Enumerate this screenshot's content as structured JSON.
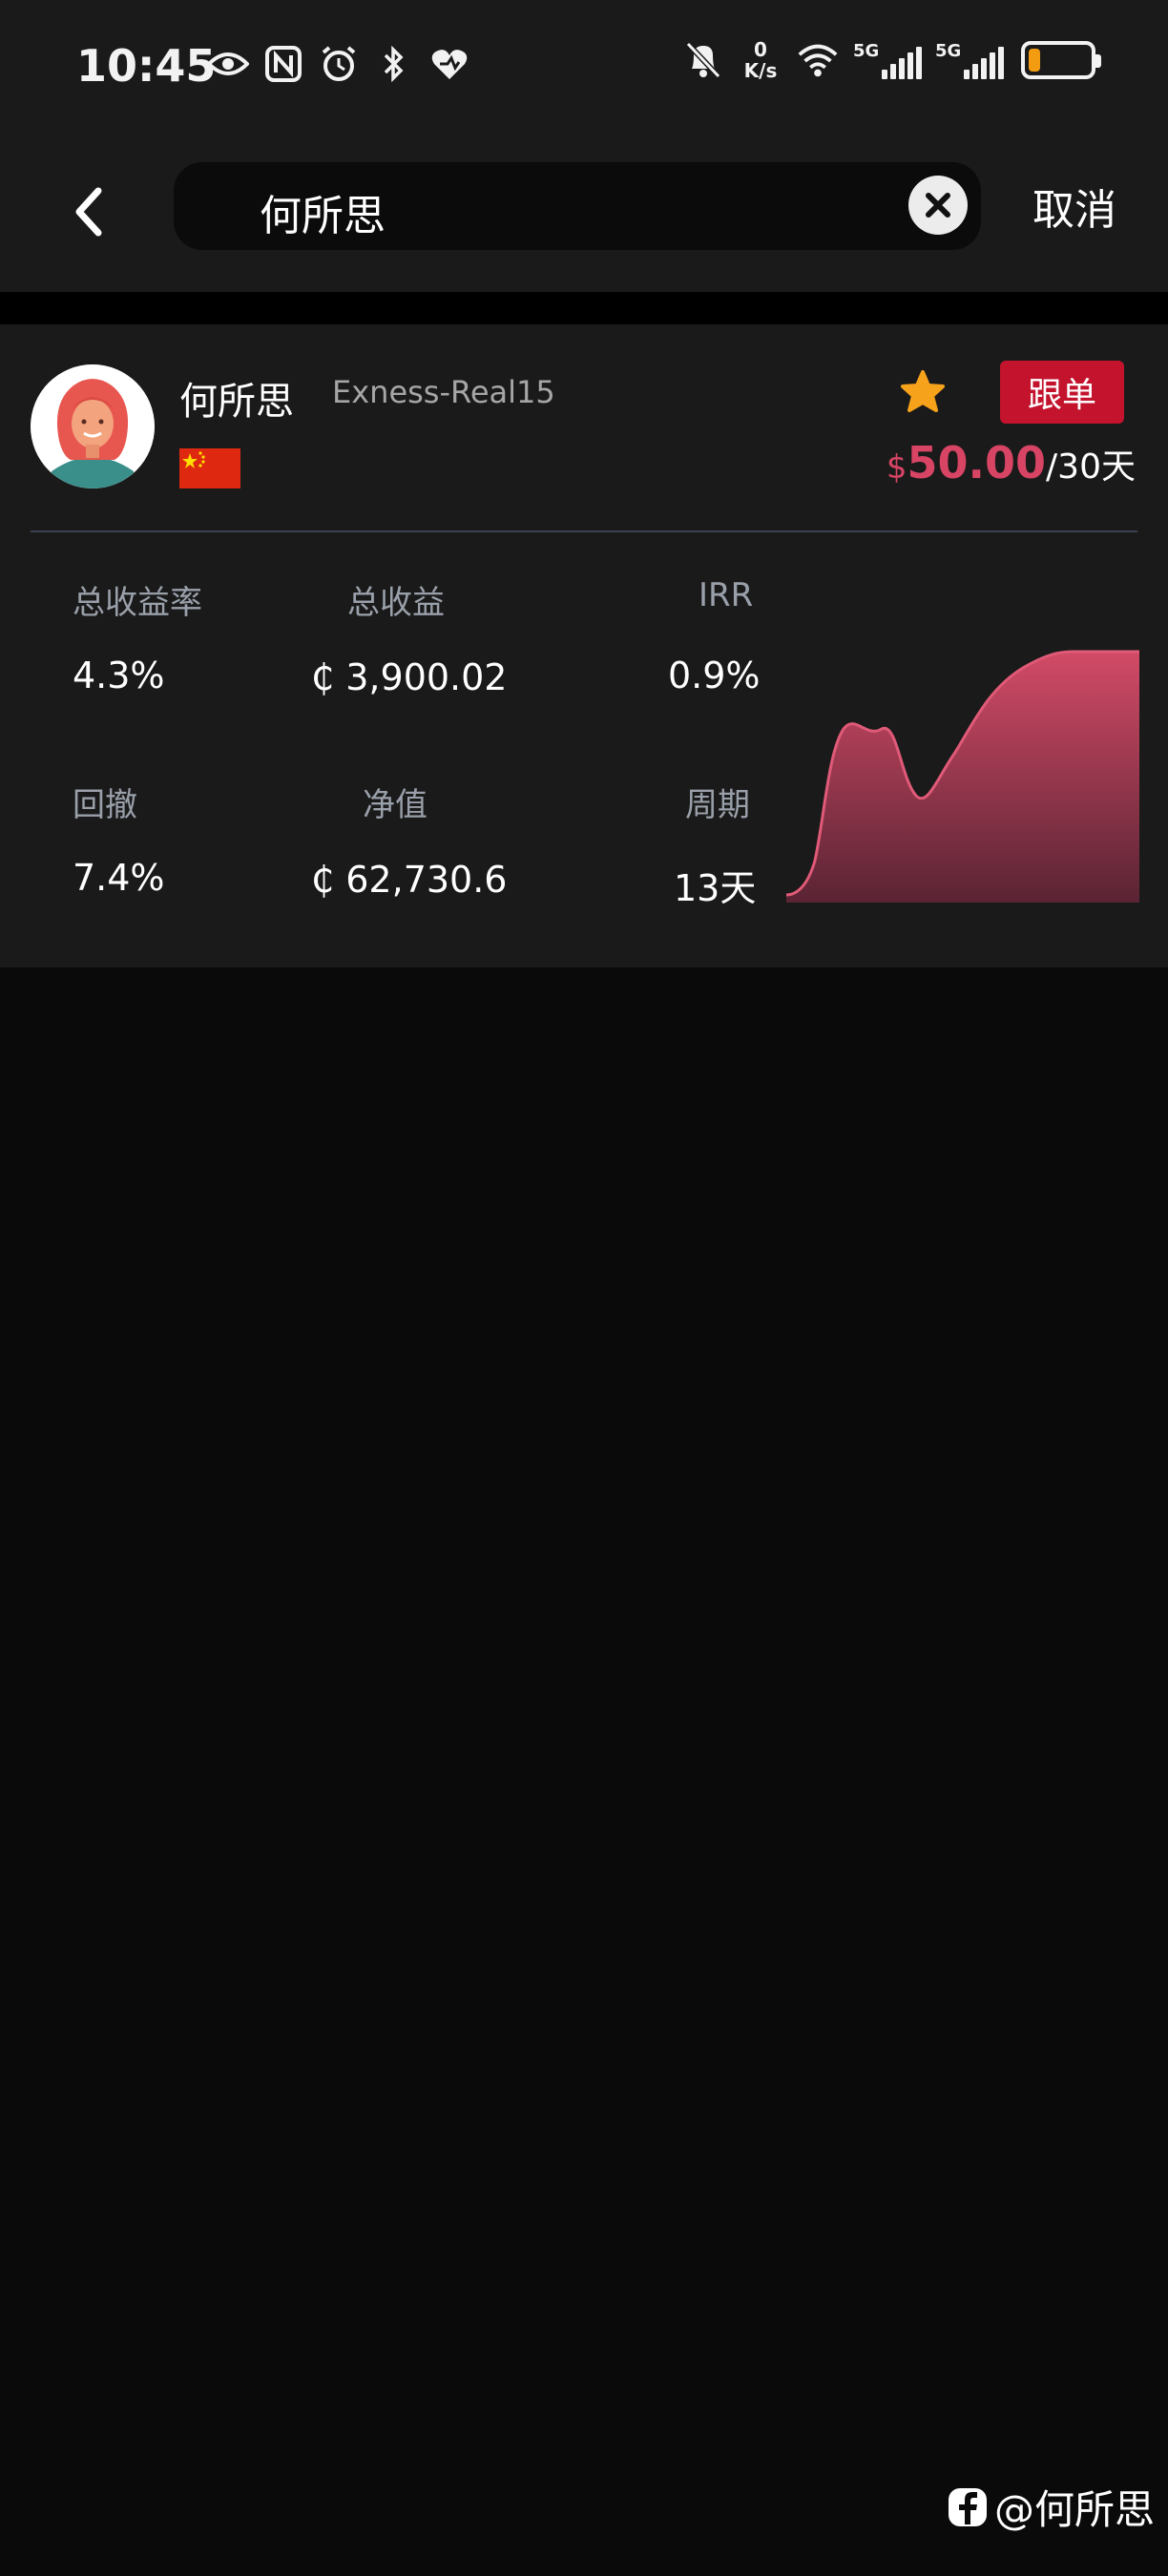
{
  "status_bar": {
    "time": "10:45",
    "net_speed_value": "0",
    "net_speed_unit": "K/s",
    "signal_1_label": "5G",
    "signal_2_label": "5G",
    "icons": [
      "eye-icon",
      "nfc-icon",
      "alarm-icon",
      "bluetooth-icon",
      "heart-app-icon",
      "mute-bell-icon",
      "wifi-icon",
      "signal-icon",
      "battery-icon"
    ],
    "battery_level": 0.2
  },
  "search": {
    "query": "何所思",
    "cancel_label": "取消"
  },
  "trader": {
    "name": "何所思",
    "account": "Exness-Real15",
    "follow_label": "跟单",
    "currency_symbol": "$",
    "price": "50.00",
    "period": "/30天",
    "metrics": {
      "total_return_rate_label": "总收益率",
      "total_return_rate_value": "4.3%",
      "total_profit_label": "总收益",
      "total_profit_value": "₵ 3,900.02",
      "irr_label": "IRR",
      "irr_value": "0.9%",
      "drawdown_label": "回撤",
      "drawdown_value": "7.4%",
      "equity_label": "净值",
      "equity_value": "₵ 62,730.6",
      "cycle_label": "周期",
      "cycle_value": "13天"
    }
  },
  "colors": {
    "accent": "#c3132d",
    "price": "#d74464",
    "star": "#f7a21b",
    "background": "#0a0a0a",
    "card": "#1a1a1a"
  },
  "watermark": "@何所思"
}
